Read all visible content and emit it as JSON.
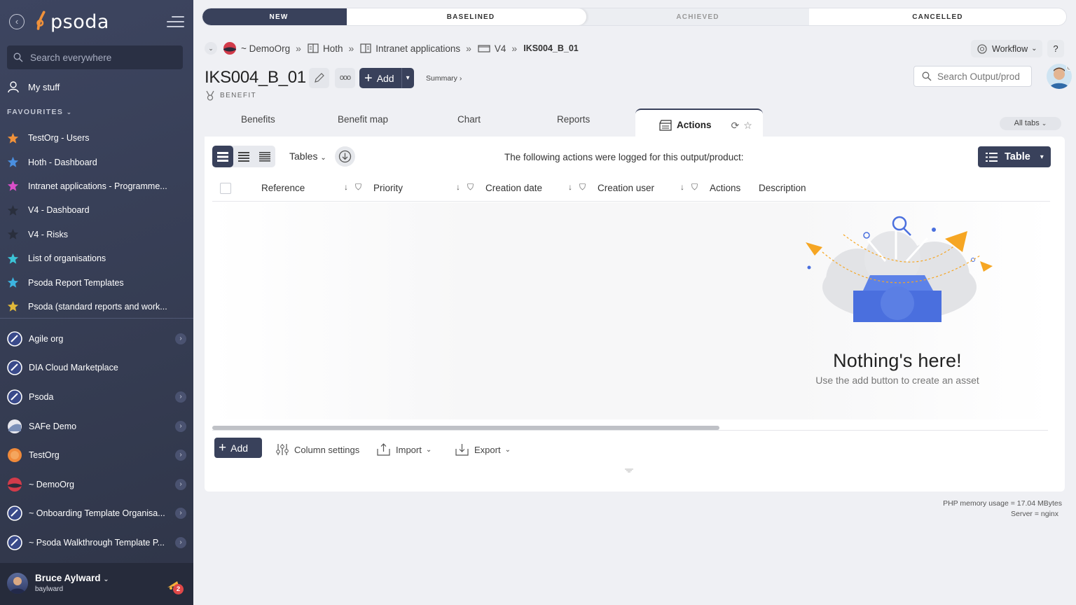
{
  "sidebar": {
    "logo_text": "psoda",
    "search_placeholder": "Search everywhere",
    "my_stuff": "My stuff",
    "favourites_heading": "FAVOURITES",
    "favourites": [
      {
        "label": "TestOrg - Users",
        "color": "#f0913a"
      },
      {
        "label": "Hoth - Dashboard",
        "color": "#4a8fe0"
      },
      {
        "label": "Intranet applications - Programme...",
        "color": "#d94fc9"
      },
      {
        "label": "V4 - Dashboard",
        "color": "#2a2f3d"
      },
      {
        "label": "V4 - Risks",
        "color": "#2a2f3d"
      },
      {
        "label": "List of organisations",
        "color": "#3cc3d6"
      },
      {
        "label": "Psoda Report Templates",
        "color": "#3cb4e0"
      },
      {
        "label": "Psoda (standard reports and work...",
        "color": "#e0b83a"
      }
    ],
    "orgs": [
      {
        "label": "Agile org",
        "expandable": true
      },
      {
        "label": "DIA Cloud Marketplace",
        "expandable": false
      },
      {
        "label": "Psoda",
        "expandable": true
      },
      {
        "label": "SAFe Demo",
        "expandable": true
      },
      {
        "label": "TestOrg",
        "expandable": true
      },
      {
        "label": "~ DemoOrg",
        "expandable": true
      },
      {
        "label": "~ Onboarding Template Organisa...",
        "expandable": true
      },
      {
        "label": "~ Psoda Walkthrough Template P...",
        "expandable": true
      }
    ],
    "user": {
      "name": "Bruce Aylward",
      "handle": "baylward",
      "notifications": "2"
    }
  },
  "stages": {
    "new": "NEW",
    "baselined": "BASELINED",
    "achieved": "ACHIEVED",
    "cancelled": "CANCELLED"
  },
  "breadcrumb": {
    "org": "~ DemoOrg",
    "portfolio": "Hoth",
    "programme": "Intranet applications",
    "project": "V4",
    "current": "IKS004_B_01"
  },
  "header": {
    "title": "IKS004_B_01",
    "subtitle": "BENEFIT",
    "add_label": "Add",
    "summary_label": "Summary ›",
    "workflow_label": "Workflow",
    "help_label": "?",
    "search_placeholder": "Search Output/prod"
  },
  "tabs": [
    "Benefits",
    "Benefit map",
    "Chart",
    "Reports",
    "Actions"
  ],
  "all_tabs_label": "All tabs",
  "panel": {
    "tables_label": "Tables",
    "message": "The following actions were logged for this output/product:",
    "table_button": "Table",
    "columns": [
      "Reference",
      "Priority",
      "Creation date",
      "Creation user",
      "Actions",
      "Description"
    ],
    "empty_title": "Nothing's here!",
    "empty_subtitle": "Use the add button to create an asset",
    "footer": {
      "add": "Add",
      "column_settings": "Column settings",
      "import": "Import",
      "export": "Export"
    }
  },
  "server": {
    "memory": "PHP memory usage = 17.04 MBytes",
    "server": "Server = nginx"
  },
  "colors": {
    "primary": "#39415b",
    "sidebar": "#353c52",
    "accent": "#f0913a"
  }
}
